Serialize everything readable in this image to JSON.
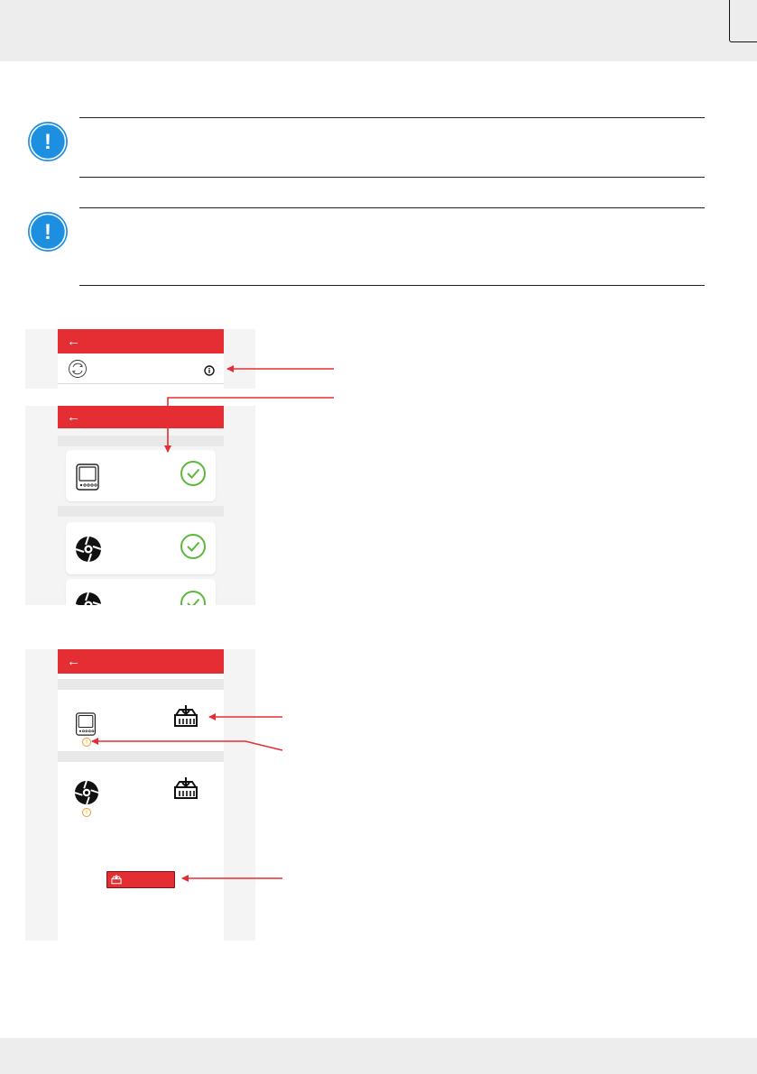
{
  "header": {
    "icon": "back-arrow-icon",
    "back_glyph": "←"
  },
  "notices": [
    {
      "icon": "exclamation-icon",
      "glyph": "!"
    },
    {
      "icon": "exclamation-icon",
      "glyph": "!"
    }
  ],
  "screen_one": {
    "sync_icon": "sync-icon",
    "info_icon": "info-icon",
    "info_glyph": "ⓘ"
  },
  "screen_two": {
    "devices": [
      {
        "icon": "thermostat-icon",
        "status_icon": "check-circle-icon"
      },
      {
        "icon": "fan-coil-icon",
        "status_icon": "check-circle-icon"
      },
      {
        "icon": "fan-coil-icon",
        "status_icon": "check-circle-icon"
      }
    ]
  },
  "screen_three": {
    "devices": [
      {
        "icon": "thermostat-icon",
        "action_icon": "firmware-download-icon",
        "warning_glyph": "i"
      },
      {
        "icon": "fan-coil-icon",
        "action_icon": "firmware-download-icon",
        "warning_glyph": "i"
      }
    ],
    "update_button_icon": "firmware-download-icon"
  },
  "colors": {
    "brand_red": "#e52e33",
    "info_blue": "#1d8fe1",
    "success_green": "#5cb83a",
    "warning_orange": "#e2a020"
  }
}
